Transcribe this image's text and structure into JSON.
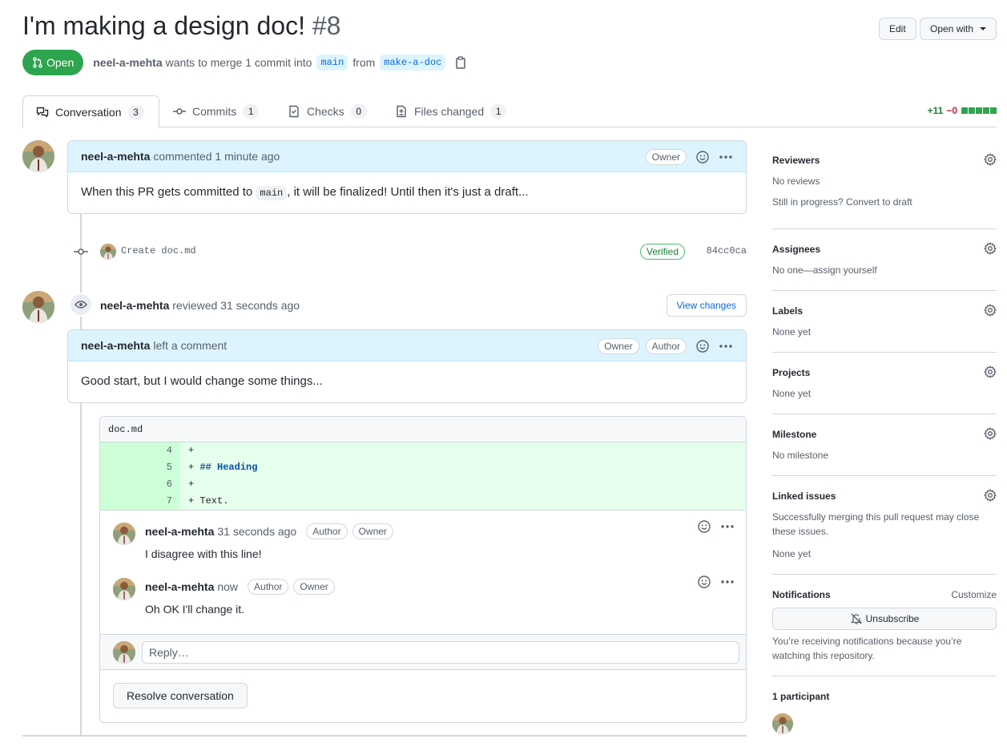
{
  "header": {
    "title": "I'm making a design doc!",
    "number": "#8",
    "edit_label": "Edit",
    "open_with_label": "Open with"
  },
  "state": {
    "badge": "Open",
    "author": "neel-a-mehta",
    "merge_text": "wants to merge 1 commit into",
    "base_branch": "main",
    "from_text": "from",
    "head_branch": "make-a-doc"
  },
  "tabs": [
    {
      "label": "Conversation",
      "count": "3",
      "icon": "comment-discussion-icon"
    },
    {
      "label": "Commits",
      "count": "1",
      "icon": "git-commit-icon"
    },
    {
      "label": "Checks",
      "count": "0",
      "icon": "checklist-icon"
    },
    {
      "label": "Files changed",
      "count": "1",
      "icon": "file-diff-icon"
    }
  ],
  "diffstat": {
    "additions": "+11",
    "deletions": "−0"
  },
  "comment1": {
    "author": "neel-a-mehta",
    "action": "commented 1 minute ago",
    "role": "Owner",
    "body_before": "When this PR gets committed to",
    "body_code": "main",
    "body_after": ", it will be finalized! Until then it's just a draft..."
  },
  "commit": {
    "message": "Create doc.md",
    "verified": "Verified",
    "sha": "84cc0ca"
  },
  "review": {
    "author": "neel-a-mehta",
    "action": "reviewed 31 seconds ago",
    "view_changes": "View changes",
    "comment_author": "neel-a-mehta",
    "comment_action": "left a comment",
    "roles": [
      "Owner",
      "Author"
    ],
    "body": "Good start, but I would change some things..."
  },
  "thread": {
    "file": "doc.md",
    "lines": [
      {
        "num": "4",
        "code": "+ "
      },
      {
        "num": "5",
        "prefix": "+ ",
        "code": "## Heading"
      },
      {
        "num": "6",
        "code": "+ "
      },
      {
        "num": "7",
        "code": "+ Text."
      }
    ],
    "comments": [
      {
        "author": "neel-a-mehta",
        "time": "31 seconds ago",
        "roles": [
          "Author",
          "Owner"
        ],
        "body": "I disagree with this line!"
      },
      {
        "author": "neel-a-mehta",
        "time": "now",
        "roles": [
          "Author",
          "Owner"
        ],
        "body": "Oh OK I'll change it."
      }
    ],
    "reply_placeholder": "Reply…",
    "resolve_label": "Resolve conversation"
  },
  "sidebar": {
    "reviewers": {
      "title": "Reviewers",
      "line1": "No reviews",
      "line2": "Still in progress? Convert to draft"
    },
    "assignees": {
      "title": "Assignees",
      "line1": "No one—assign yourself"
    },
    "labels": {
      "title": "Labels",
      "line1": "None yet"
    },
    "projects": {
      "title": "Projects",
      "line1": "None yet"
    },
    "milestone": {
      "title": "Milestone",
      "line1": "No milestone"
    },
    "linked": {
      "title": "Linked issues",
      "line1": "Successfully merging this pull request may close",
      "line2": "these issues.",
      "line3": "None yet"
    },
    "notifications": {
      "title": "Notifications",
      "customize": "Customize",
      "button": "Unsubscribe",
      "line1": "You’re receiving notifications because you’re",
      "line2": "watching this repository."
    },
    "participants": {
      "title": "1 participant"
    }
  },
  "colors": {
    "open_green": "#2da44e",
    "link_blue": "#0969da",
    "addition_bg": "#e6ffec"
  }
}
